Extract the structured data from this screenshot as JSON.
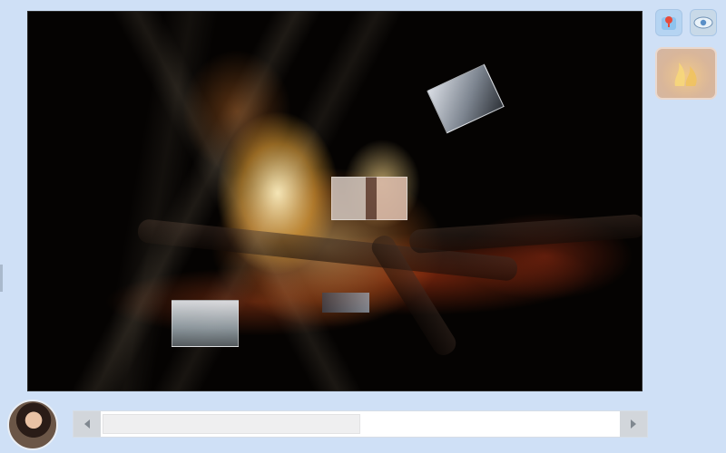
{
  "toolbar": {
    "pin_icon": "map-pin-icon",
    "eye_icon": "eye-icon",
    "thumbnail_icon": "flame-thumbnail-icon"
  },
  "canvas": {
    "photos": [
      {
        "name": "tilted-photo"
      },
      {
        "name": "portrait-photo"
      },
      {
        "name": "group-photo"
      },
      {
        "name": "small-photo"
      }
    ]
  },
  "bottom": {
    "avatar_icon": "user-avatar",
    "scroll_position": 0.45
  },
  "colors": {
    "background": "#cfe0f6",
    "accent": "#b5d4f2"
  }
}
